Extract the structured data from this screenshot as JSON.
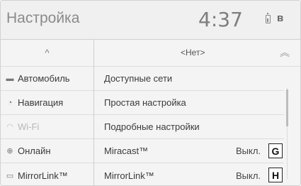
{
  "header": {
    "title": "Настройка",
    "clock": "4:37",
    "bt_glyph": "ʙ"
  },
  "sidebar": {
    "up_glyph": "^",
    "items": [
      {
        "label": "Автомобиль",
        "icon": "car-icon",
        "glyph": "▬"
      },
      {
        "label": "Навигация",
        "icon": "navigation-icon",
        "glyph": "◔"
      },
      {
        "label": "Wi-Fi",
        "icon": "wifi-icon",
        "glyph": "◠",
        "selected": true
      },
      {
        "label": "Онлайн",
        "icon": "globe-icon",
        "glyph": "⊕"
      },
      {
        "label": "MirrorLink™",
        "icon": "mirrorlink-icon",
        "glyph": "▭"
      }
    ]
  },
  "main": {
    "network_label": "<Нет>",
    "scroll_up_glyph": "︽",
    "items": [
      {
        "label": "Доступные сети"
      },
      {
        "label": "Простая настройка"
      },
      {
        "label": "Подробные настройки"
      },
      {
        "label": "Miracast™",
        "value": "Выкл.",
        "letter": "G"
      },
      {
        "label": "MirrorLink™",
        "value": "Выкл.",
        "letter": "H"
      }
    ]
  }
}
